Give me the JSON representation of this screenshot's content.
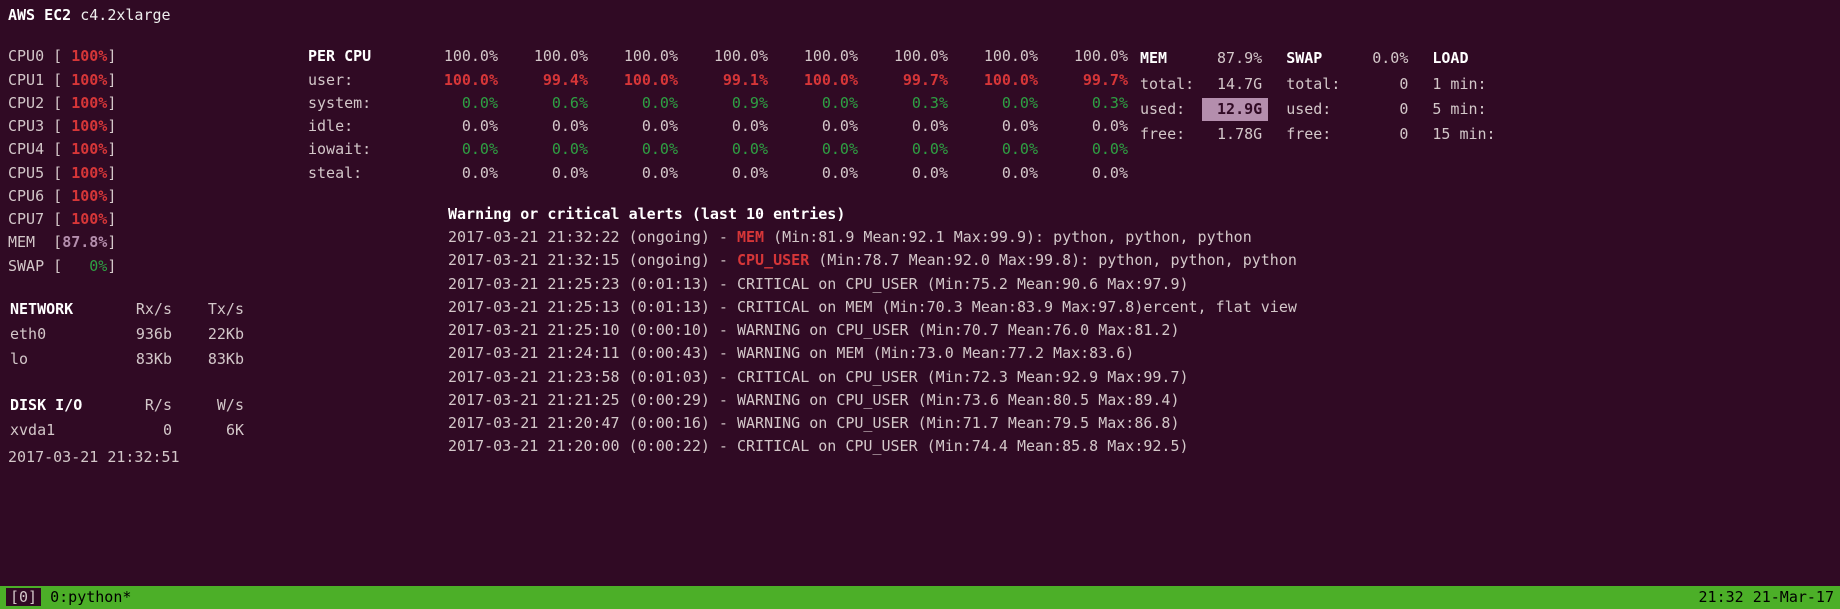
{
  "header": {
    "title_a": "AWS EC2",
    "title_b": "c4.2xlarge"
  },
  "cpu_bars": [
    {
      "name": "CPU0",
      "val": "100%",
      "cls": "red"
    },
    {
      "name": "CPU1",
      "val": "100%",
      "cls": "red"
    },
    {
      "name": "CPU2",
      "val": "100%",
      "cls": "red"
    },
    {
      "name": "CPU3",
      "val": "100%",
      "cls": "red"
    },
    {
      "name": "CPU4",
      "val": "100%",
      "cls": "red"
    },
    {
      "name": "CPU5",
      "val": "100%",
      "cls": "red"
    },
    {
      "name": "CPU6",
      "val": "100%",
      "cls": "red"
    },
    {
      "name": "CPU7",
      "val": "100%",
      "cls": "red"
    },
    {
      "name": "MEM",
      "val": "87.8%",
      "cls": "purple"
    },
    {
      "name": "SWAP",
      "val": "0%",
      "cls": "green"
    }
  ],
  "percpu": {
    "title": "PER CPU",
    "header": [
      "100.0%",
      "100.0%",
      "100.0%",
      "100.0%",
      "100.0%",
      "100.0%",
      "100.0%",
      "100.0%"
    ],
    "rows": [
      {
        "label": "user:",
        "cls": "red",
        "vals": [
          "100.0%",
          "99.4%",
          "100.0%",
          "99.1%",
          "100.0%",
          "99.7%",
          "100.0%",
          "99.7%"
        ]
      },
      {
        "label": "system:",
        "cls": "green",
        "vals": [
          "0.0%",
          "0.6%",
          "0.0%",
          "0.9%",
          "0.0%",
          "0.3%",
          "0.0%",
          "0.3%"
        ]
      },
      {
        "label": "idle:",
        "cls": "",
        "vals": [
          "0.0%",
          "0.0%",
          "0.0%",
          "0.0%",
          "0.0%",
          "0.0%",
          "0.0%",
          "0.0%"
        ]
      },
      {
        "label": "iowait:",
        "cls": "green",
        "vals": [
          "0.0%",
          "0.0%",
          "0.0%",
          "0.0%",
          "0.0%",
          "0.0%",
          "0.0%",
          "0.0%"
        ]
      },
      {
        "label": "steal:",
        "cls": "",
        "vals": [
          "0.0%",
          "0.0%",
          "0.0%",
          "0.0%",
          "0.0%",
          "0.0%",
          "0.0%",
          "0.0%"
        ]
      }
    ]
  },
  "mem": {
    "title": "MEM",
    "pct": "87.9%",
    "rows": [
      {
        "l": "total:",
        "v": "14.7G"
      },
      {
        "l": "used:",
        "v": "12.9G",
        "hl": true
      },
      {
        "l": "free:",
        "v": "1.78G"
      }
    ]
  },
  "swap": {
    "title": "SWAP",
    "pct": "0.0%",
    "rows": [
      {
        "l": "total:",
        "v": "0"
      },
      {
        "l": "used:",
        "v": "0"
      },
      {
        "l": "free:",
        "v": "0"
      }
    ]
  },
  "load": {
    "title": "LOAD",
    "rows": [
      "1 min:",
      "5 min:",
      "15 min:"
    ]
  },
  "network": {
    "title": "NETWORK",
    "h": [
      "Rx/s",
      "Tx/s"
    ],
    "rows": [
      {
        "n": "eth0",
        "rx": "936b",
        "tx": "22Kb"
      },
      {
        "n": "lo",
        "rx": "83Kb",
        "tx": "83Kb"
      }
    ]
  },
  "disk": {
    "title": "DISK I/O",
    "h": [
      "R/s",
      "W/s"
    ],
    "rows": [
      {
        "n": "xvda1",
        "r": "0",
        "w": "6K"
      }
    ]
  },
  "clock": "2017-03-21 21:32:51",
  "alerts": {
    "title": "Warning or critical alerts (last 10 entries)",
    "lines": [
      {
        "t": "2017-03-21 21:32:22 (ongoing) - ",
        "tag": "MEM",
        "tagcls": "hlred",
        "rest": " (Min:81.9 Mean:92.1 Max:99.9): python, python, python"
      },
      {
        "t": "2017-03-21 21:32:15 (ongoing) - ",
        "tag": "CPU_USER",
        "tagcls": "hlred",
        "rest": " (Min:78.7 Mean:92.0 Max:99.8): python, python, python"
      },
      {
        "t": "2017-03-21 21:25:23 (0:01:13) - CRITICAL on CPU_USER (Min:75.2 Mean:90.6 Max:97.9)"
      },
      {
        "t": "2017-03-21 21:25:13 (0:01:13) - CRITICAL on MEM (Min:70.3 Mean:83.9 Max:97.8)ercent, flat view"
      },
      {
        "t": "2017-03-21 21:25:10 (0:00:10) - WARNING on CPU_USER (Min:70.7 Mean:76.0 Max:81.2)"
      },
      {
        "t": "2017-03-21 21:24:11 (0:00:43) - WARNING on MEM (Min:73.0 Mean:77.2 Max:83.6)"
      },
      {
        "t": "2017-03-21 21:23:58 (0:01:03) - CRITICAL on CPU_USER (Min:72.3 Mean:92.9 Max:99.7)"
      },
      {
        "t": "2017-03-21 21:21:25 (0:00:29) - WARNING on CPU_USER (Min:73.6 Mean:80.5 Max:89.4)"
      },
      {
        "t": "2017-03-21 21:20:47 (0:00:16) - WARNING on CPU_USER (Min:71.7 Mean:79.5 Max:86.8)"
      },
      {
        "t": "2017-03-21 21:20:00 (0:00:22) - CRITICAL on CPU_USER (Min:74.4 Mean:85.8 Max:92.5)"
      }
    ]
  },
  "status": {
    "left_sel": "[0]",
    "left": " 0:python*",
    "right": "21:32 21-Mar-17"
  }
}
